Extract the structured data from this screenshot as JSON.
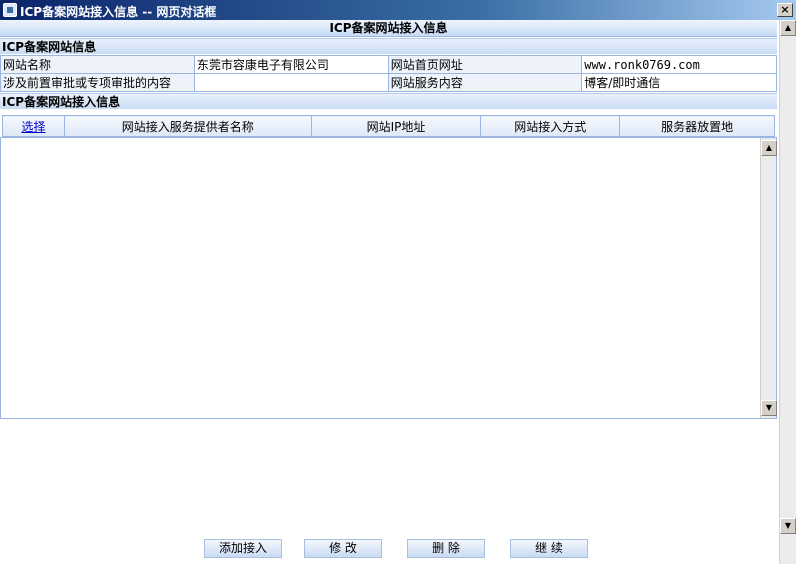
{
  "window": {
    "title": "ICP备案网站接入信息 -- 网页对话框",
    "close_glyph": "×"
  },
  "page_header": "ICP备案网站接入信息",
  "website_info": {
    "section_title": "ICP备案网站信息",
    "rows": [
      {
        "label1": "网站名称",
        "value1": "东莞市容康电子有限公司",
        "label2": "网站首页网址",
        "value2": "www.ronk0769.com"
      },
      {
        "label1": "涉及前置审批或专项审批的内容",
        "value1": "",
        "label2": "网站服务内容",
        "value2": "博客/即时通信"
      }
    ]
  },
  "access_info": {
    "section_title": "ICP备案网站接入信息",
    "columns": [
      "选择",
      "网站接入服务提供者名称",
      "网站IP地址",
      "网站接入方式",
      "服务器放置地"
    ],
    "rows": []
  },
  "buttons": {
    "add": "添加接入",
    "edit": "修 改",
    "delete": "删 除",
    "continue": "继 续"
  },
  "scroll_glyphs": {
    "up": "▲",
    "down": "▼"
  }
}
